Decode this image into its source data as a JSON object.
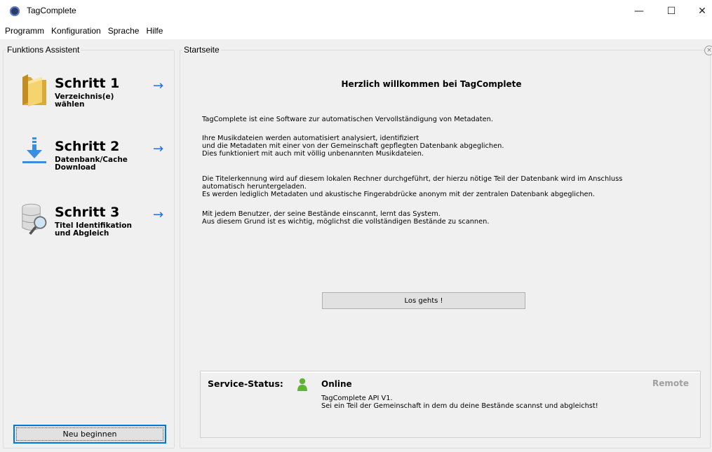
{
  "window": {
    "title": "TagComplete",
    "minimize_glyph": "—",
    "maximize_glyph": "☐",
    "close_glyph": "✕"
  },
  "menu": [
    "Programm",
    "Konfiguration",
    "Sprache",
    "Hilfe"
  ],
  "left_panel": {
    "title": "Funktions Assistent",
    "steps": [
      {
        "title": "Schritt 1",
        "subtitle": "Verzeichnis(e) wählen",
        "icon": "folder-icon"
      },
      {
        "title": "Schritt 2",
        "subtitle": "Datenbank/Cache Download",
        "icon": "download-icon"
      },
      {
        "title": "Schritt 3",
        "subtitle": "Titel Identifikation und Abgleich",
        "icon": "database-search-icon"
      }
    ],
    "arrow": "→",
    "reset_button": "Neu beginnen"
  },
  "right_panel": {
    "title": "Startseite",
    "close_glyph": "×",
    "welcome": "Herzlich willkommen bei TagComplete",
    "paragraphs": [
      [
        "TagComplete ist eine Software zur automatischen Vervollständigung von Metadaten."
      ],
      [
        "Ihre Musikdateien werden automatisiert analysiert, identifiziert",
        "und die Metadaten mit einer von der Gemeinschaft gepflegten Datenbank abgeglichen.",
        "Dies funktioniert mit auch mit völlig unbenannten Musikdateien."
      ],
      [
        "Die Titelerkennung wird auf diesem lokalen Rechner durchgeführt, der hierzu nötige Teil der Datenbank wird im Anschluss",
        "automatisch heruntergeladen.",
        "Es werden lediglich Metadaten und akustische Fingerabdrücke anonym mit der zentralen Datenbank abgeglichen."
      ],
      [
        "Mit jedem Benutzer, der seine Bestände einscannt, lernt das System.",
        "Aus diesem Grund ist es wichtig, möglichst die vollständigen Bestände zu scannen."
      ]
    ],
    "go_button": "Los gehts !"
  },
  "service_status": {
    "label": "Service-Status:",
    "state": "Online",
    "mode": "Remote",
    "api": "TagComplete API V1.",
    "message": "Sei ein Teil der Gemeinschaft in dem du deine Bestände scannst und abgleichst!",
    "icon": "user-icon",
    "state_color": "#5fb336"
  },
  "colors": {
    "accent": "#0078d7",
    "arrow": "#1e73d8"
  }
}
